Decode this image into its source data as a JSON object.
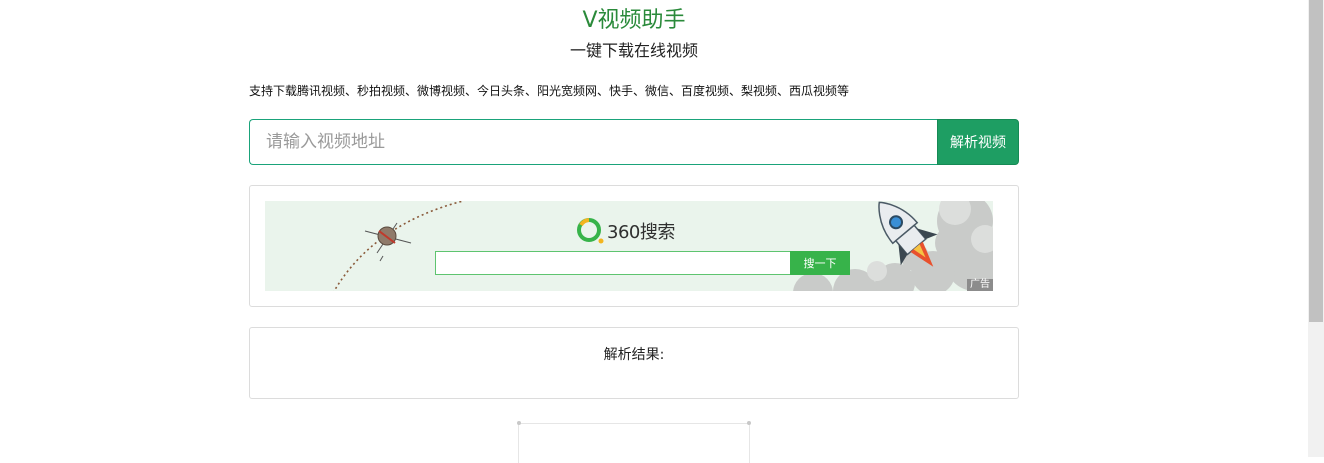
{
  "header": {
    "title": "V视频助手",
    "subtitle": "一键下载在线视频"
  },
  "supported_sites": "支持下载腾讯视频、秒拍视频、微博视频、今日头条、阳光宽频网、快手、微信、百度视频、梨视频、西瓜视频等",
  "search": {
    "placeholder": "请输入视频地址",
    "value": "",
    "button_label": "解析视频"
  },
  "ad": {
    "logo_text": "360搜索",
    "search_button": "搜一下",
    "ad_label": "广告",
    "logo_color": "#37b34a"
  },
  "result": {
    "title": "解析结果:"
  },
  "colors": {
    "title": "#2a8a3a",
    "accent": "#1e9e63",
    "input_border": "#1aa37a"
  }
}
